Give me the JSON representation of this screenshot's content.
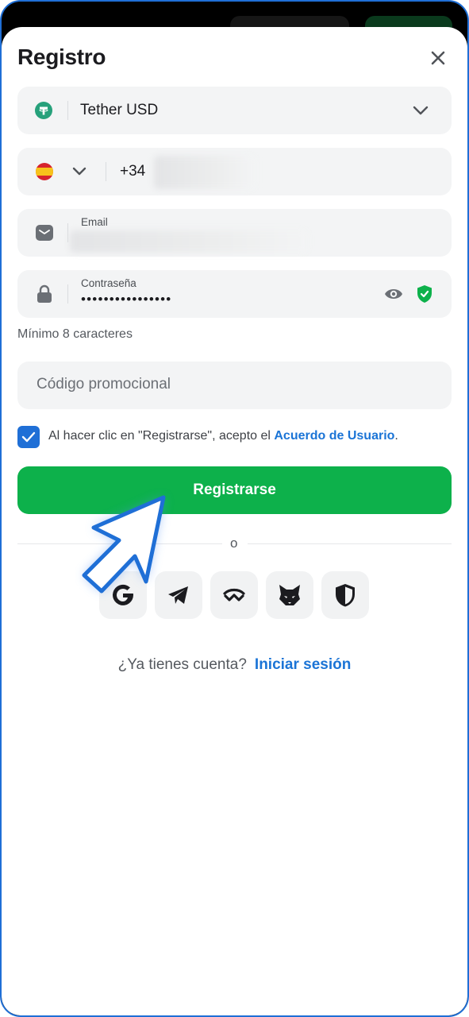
{
  "dialog": {
    "title": "Registro"
  },
  "currency": {
    "selected": "Tether USD",
    "icon": "tether-icon",
    "accent": "#26a17b"
  },
  "phone": {
    "country_icon": "spain-flag-icon",
    "prefix": "+34"
  },
  "email": {
    "label": "Email"
  },
  "password": {
    "label": "Contraseña",
    "value": "••••••••••••••••",
    "hint": "Mínimo 8 caracteres"
  },
  "promo": {
    "placeholder": "Código promocional"
  },
  "terms": {
    "checked": true,
    "text": "Al hacer clic en \"Registrarse\", acepto el ",
    "link": "Acuerdo de Usuario",
    "suffix": "."
  },
  "submit": {
    "label": "Registrarse",
    "color": "#0db14b"
  },
  "separator": {
    "label": "o"
  },
  "social": [
    {
      "icon": "google-icon"
    },
    {
      "icon": "telegram-icon"
    },
    {
      "icon": "walletconnect-icon"
    },
    {
      "icon": "metamask-fox-icon"
    },
    {
      "icon": "shield-icon"
    }
  ],
  "login": {
    "question": "¿Ya tienes cuenta?",
    "link": "Iniciar sesión"
  },
  "colors": {
    "link": "#1b74d6",
    "frame_border": "#1f6fd6"
  }
}
